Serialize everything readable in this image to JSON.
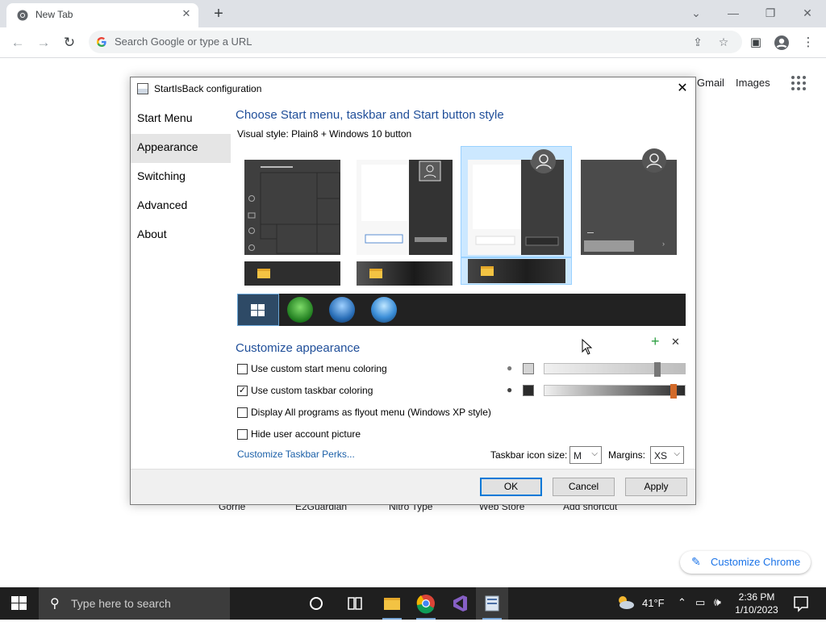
{
  "browser": {
    "tab_title": "New Tab",
    "tab_close": "✕",
    "new_tab": "+",
    "omnibox_placeholder": "Search Google or type a URL",
    "window_controls": {
      "dropdown": "⌄",
      "minimize": "—",
      "restore": "❐",
      "close": "✕"
    }
  },
  "ntp": {
    "links": [
      "Gmail",
      "Images"
    ],
    "shortcuts": [
      "Gorrie",
      "E2Guardian",
      "Nitro Type",
      "Web Store",
      "Add shortcut"
    ],
    "customize_chrome": "Customize Chrome"
  },
  "dialog": {
    "title": "StartIsBack configuration",
    "close": "✕",
    "nav": [
      "Start Menu",
      "Appearance",
      "Switching",
      "Advanced",
      "About"
    ],
    "nav_selected": "Appearance",
    "style_heading": "Choose Start menu, taskbar and Start button style",
    "visual_style": "Visual style:  Plain8 + Windows 10 button",
    "customize_heading": "Customize appearance",
    "add_icon": "+",
    "remove_icon": "✕",
    "checkboxes": [
      {
        "label": "Use custom start menu coloring",
        "checked": false,
        "mark": ""
      },
      {
        "label": "Use custom taskbar coloring",
        "checked": true,
        "mark": "✓"
      },
      {
        "label": "Display All programs as flyout menu (Windows XP style)",
        "checked": false,
        "mark": ""
      },
      {
        "label": "Hide user account picture",
        "checked": false,
        "mark": ""
      }
    ],
    "start_menu_slider_level": 0.82,
    "taskbar_slider_level": 0.94,
    "start_menu_swatch": "#d4d4d4",
    "taskbar_swatch": "#2b2b2b",
    "taskbar_slider_accent": "#d26a2a",
    "perks_link": "Customize Taskbar Perks...",
    "icon_size_label": "Taskbar icon size:",
    "icon_size_value": "M",
    "margins_label": "Margins:",
    "margins_value": "XS",
    "buttons": {
      "ok": "OK",
      "cancel": "Cancel",
      "apply": "Apply"
    }
  },
  "taskbar": {
    "search_placeholder": "Type here to search",
    "weather": "41°F",
    "time": "2:36 PM",
    "date": "1/10/2023"
  }
}
